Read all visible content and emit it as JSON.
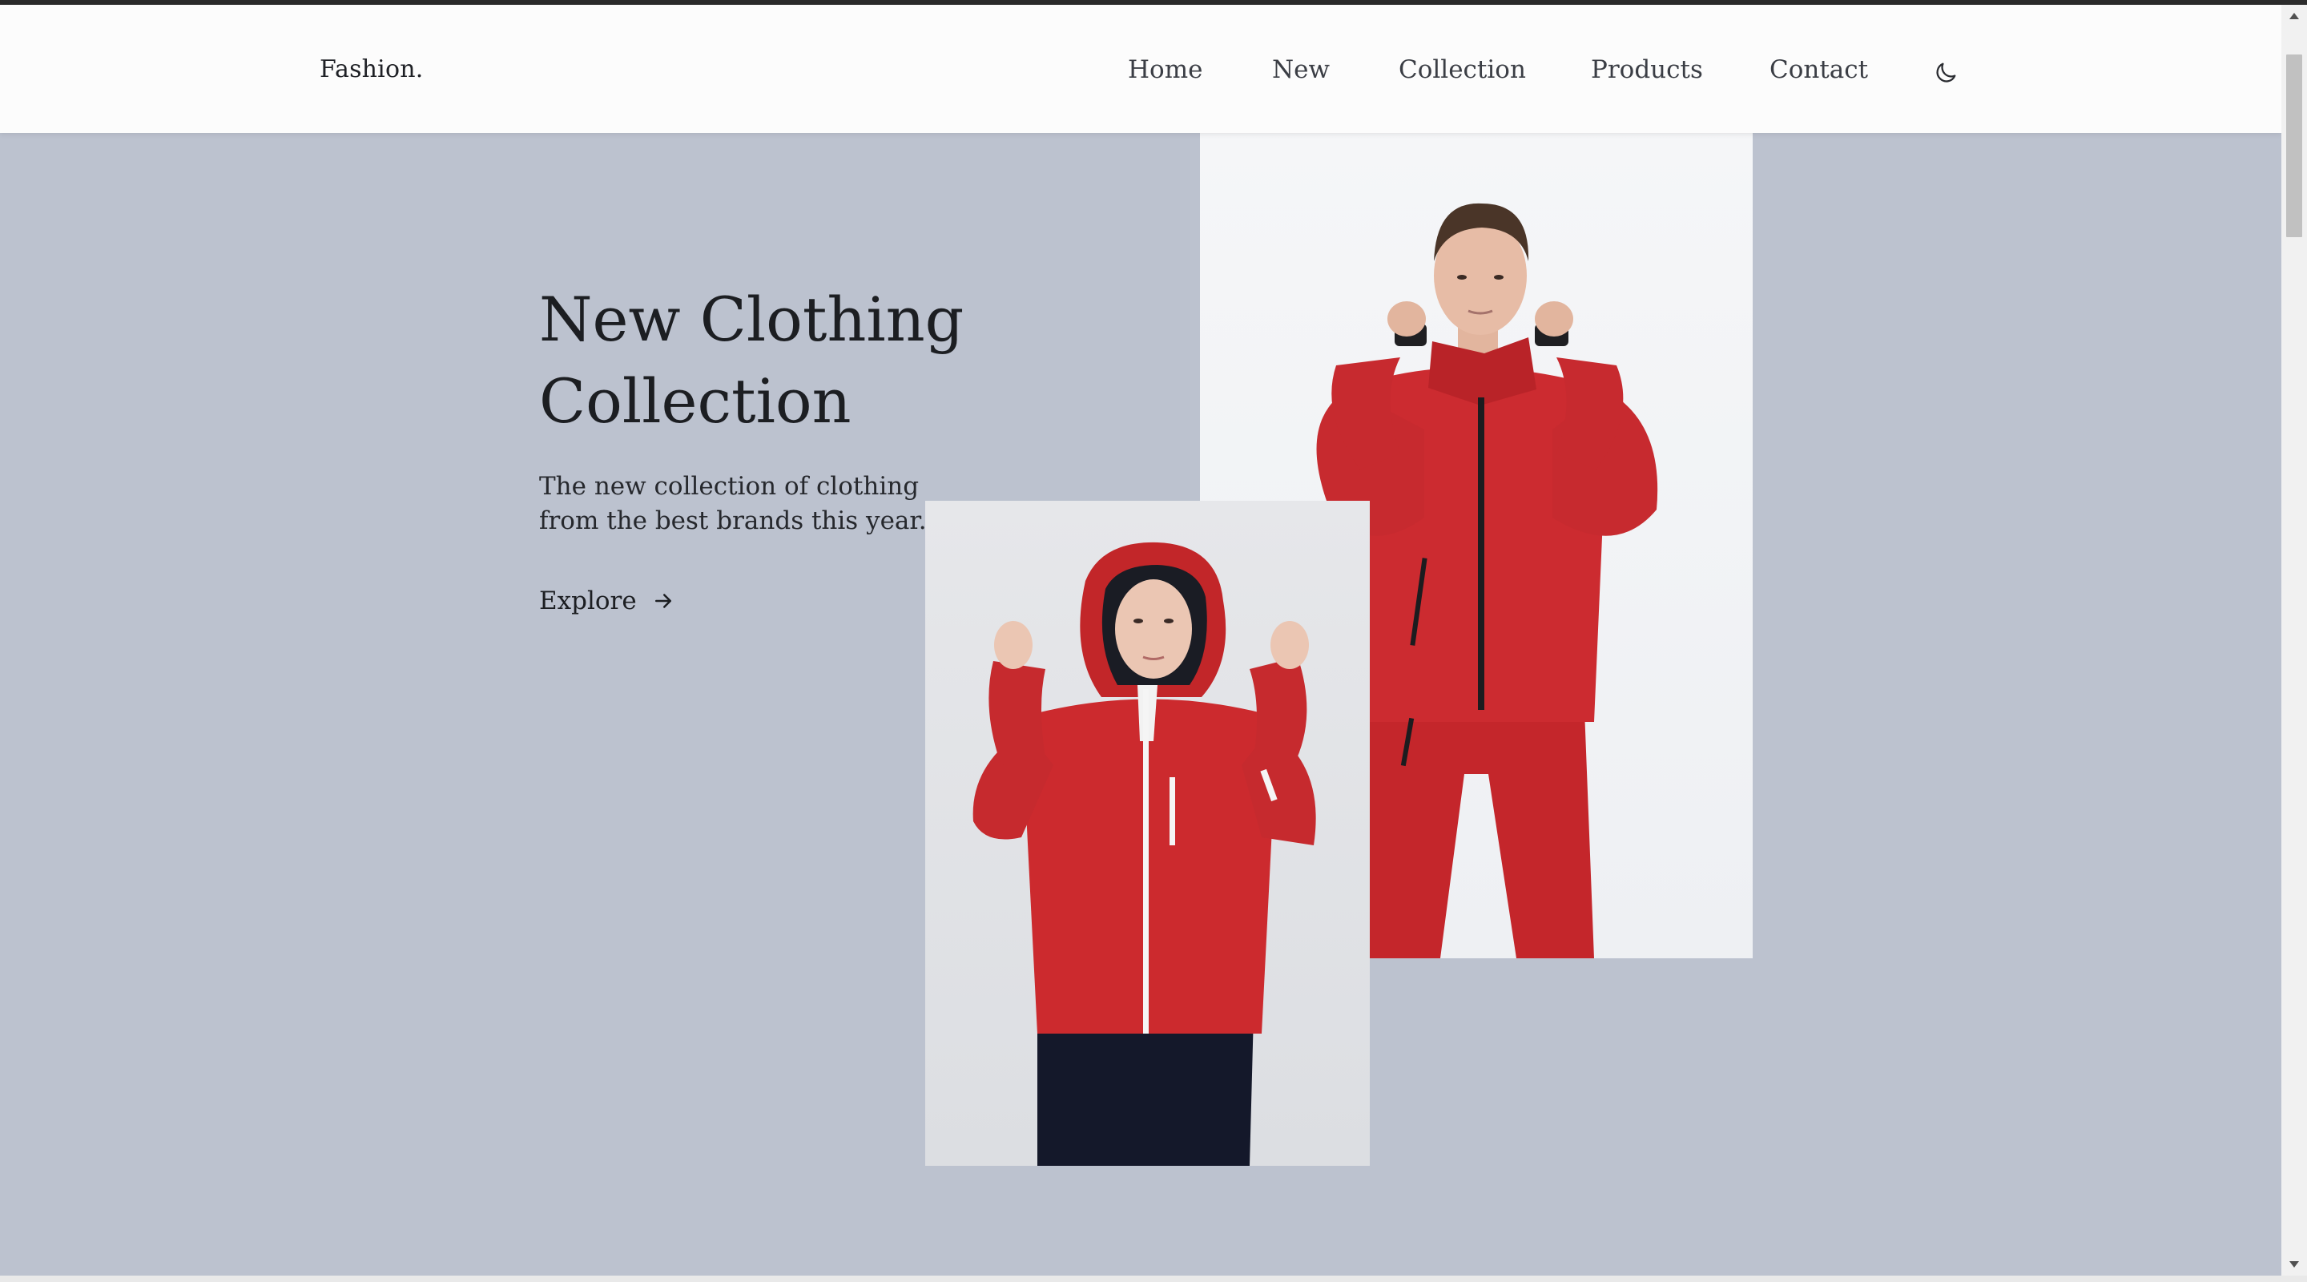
{
  "header": {
    "logo": "Fashion.",
    "nav": [
      {
        "label": "Home"
      },
      {
        "label": "New"
      },
      {
        "label": "Collection"
      },
      {
        "label": "Products"
      },
      {
        "label": "Contact"
      }
    ],
    "theme_icon": "moon-icon"
  },
  "hero": {
    "title": "New Clothing\nCollection",
    "description": "The new collection of clothing from the best brands this year.",
    "cta_label": "Explore",
    "cta_icon": "arrow-right-icon"
  },
  "images": {
    "man": "man-red-jacket-photo",
    "woman": "woman-red-hooded-jacket-photo"
  },
  "colors": {
    "hero_background": "#bcc2cf",
    "header_background": "#fcfcfc",
    "jacket_red": "#c8282d"
  }
}
